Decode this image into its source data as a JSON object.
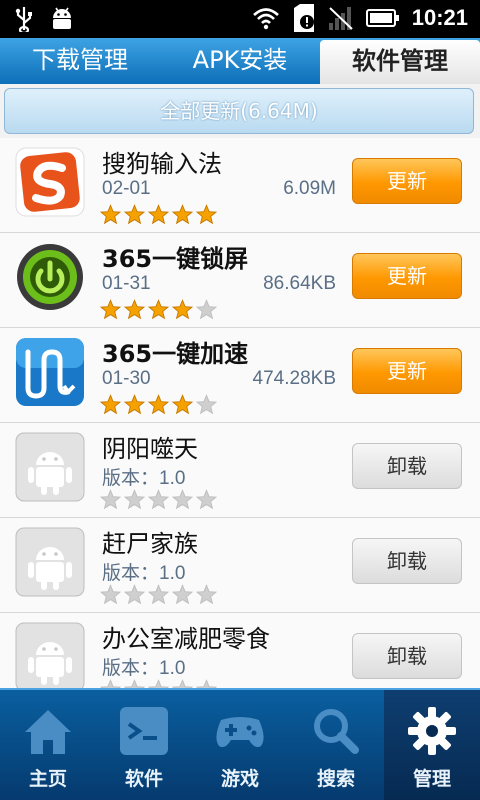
{
  "status_bar": {
    "time": "10:21"
  },
  "tabs": [
    {
      "label": "下载管理"
    },
    {
      "label": "APK安装"
    },
    {
      "label": "软件管理"
    }
  ],
  "update_all_label": "全部更新(6.64M)",
  "apps": [
    {
      "name": "搜狗输入法",
      "date": "02-01",
      "size": "6.09M",
      "rating": 5,
      "action": "更新"
    },
    {
      "name": "365一键锁屏",
      "date": "01-31",
      "size": "86.64KB",
      "rating": 4,
      "action": "更新"
    },
    {
      "name": "365一键加速",
      "date": "01-30",
      "size": "474.28KB",
      "rating": 4,
      "action": "更新"
    },
    {
      "name": "阴阳噬天",
      "date": "版本：1.0",
      "size": "",
      "rating": 0,
      "action": "卸载"
    },
    {
      "name": "赶尸家族",
      "date": "版本：1.0",
      "size": "",
      "rating": 0,
      "action": "卸载"
    },
    {
      "name": "办公室减肥零食",
      "date": "版本：1.0",
      "size": "",
      "rating": 0,
      "action": "卸载"
    }
  ],
  "bottom_nav": [
    {
      "label": "主页",
      "icon": "home-icon"
    },
    {
      "label": "软件",
      "icon": "software-icon"
    },
    {
      "label": "游戏",
      "icon": "gamepad-icon"
    },
    {
      "label": "搜索",
      "icon": "search-icon"
    },
    {
      "label": "管理",
      "icon": "gear-icon"
    }
  ],
  "colors": {
    "tab_blue": "#0d6fb8",
    "update_orange": "#ff9800",
    "star_gold": "#f5a200"
  }
}
